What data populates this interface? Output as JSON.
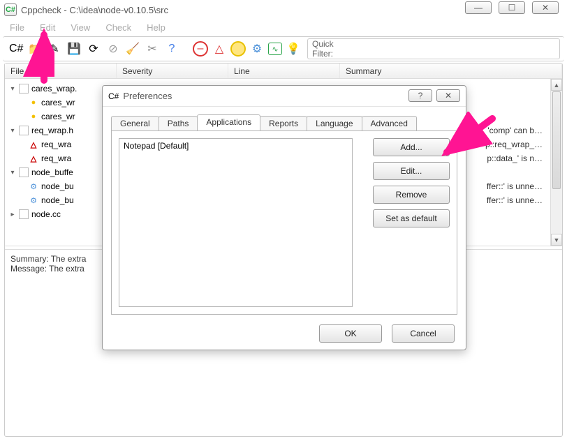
{
  "window": {
    "title": "Cppcheck - C:\\idea\\node-v0.10.5\\src",
    "app_icon_text": "C#"
  },
  "win_controls": {
    "min": "—",
    "max": "☐",
    "close": "✕"
  },
  "menubar": [
    "File",
    "Edit",
    "View",
    "Check",
    "Help"
  ],
  "quick_filter": {
    "label": "Quick Filter:",
    "value": ""
  },
  "columns": {
    "file": "File",
    "severity": "Severity",
    "line": "Line",
    "summary": "Summary"
  },
  "tree": [
    {
      "level": 0,
      "expand": "▾",
      "icon": "doc",
      "text": "cares_wrap."
    },
    {
      "level": 1,
      "expand": "",
      "icon": "style",
      "text": "cares_wr"
    },
    {
      "level": 1,
      "expand": "",
      "icon": "style",
      "text": "cares_wr"
    },
    {
      "level": 0,
      "expand": "▾",
      "icon": "doc",
      "text": "req_wrap.h"
    },
    {
      "level": 1,
      "expand": "",
      "icon": "warn",
      "text": "req_wra"
    },
    {
      "level": 1,
      "expand": "",
      "icon": "warn",
      "text": "req_wra"
    },
    {
      "level": 0,
      "expand": "▾",
      "icon": "doc",
      "text": "node_buffe"
    },
    {
      "level": 1,
      "expand": "",
      "icon": "gear",
      "text": "node_bu"
    },
    {
      "level": 1,
      "expand": "",
      "icon": "gear",
      "text": "node_bu"
    },
    {
      "level": 0,
      "expand": "▸",
      "icon": "doc",
      "text": "node.cc"
    }
  ],
  "right_rows": [
    "",
    "",
    "",
    "'comp' can b…",
    "p::req_wrap_…",
    "p::data_' is n…",
    "",
    "ffer::' is unne…",
    "ffer::' is unne…",
    ""
  ],
  "details": {
    "summary_label": "Summary: The extra",
    "message_label": "Message: The extra"
  },
  "dialog": {
    "title": "Preferences",
    "tabs": [
      "General",
      "Paths",
      "Applications",
      "Reports",
      "Language",
      "Advanced"
    ],
    "active_tab": 2,
    "app_list": [
      "Notepad [Default]"
    ],
    "buttons": {
      "add": "Add...",
      "edit": "Edit...",
      "remove": "Remove",
      "setdefault": "Set as default"
    },
    "ok": "OK",
    "cancel": "Cancel",
    "help": "?",
    "close": "✕"
  }
}
